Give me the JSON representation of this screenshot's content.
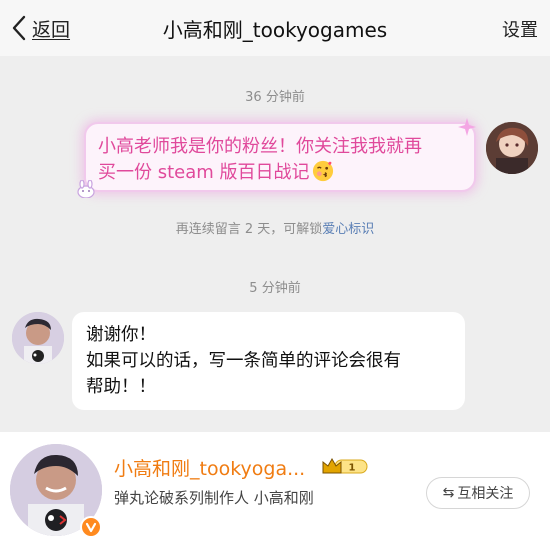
{
  "header": {
    "back_label": "返回",
    "title": "小高和刚_tookyogames",
    "settings_label": "设置"
  },
  "messages": {
    "timestamp_1": "36 分钟前",
    "fan_message_line1": "小高老师我是你的粉丝！你关注我我就再",
    "fan_message_line2": "买一份 steam 版百日战记",
    "unlock_prefix": "再连续留言 2 天，可解锁",
    "unlock_highlight": "爱心标识",
    "timestamp_2": "5 分钟前",
    "reply_line1": "谢谢你！",
    "reply_line2": "如果可以的话，写一条简单的评论会很有",
    "reply_line3": "帮助！！"
  },
  "profile_card": {
    "name": "小高和刚_tookyoga...",
    "level_badge": "1",
    "description": "弹丸论破系列制作人 小高和刚",
    "follow_label": "互相关注",
    "follow_icon": "⇆"
  },
  "icons": {
    "back": "chevron-left-icon",
    "emoji": "kiss-face-emoji",
    "crown": "crown-icon",
    "verify": "verified-badge-icon"
  },
  "colors": {
    "fan_text": "#e0499b",
    "name_orange": "#f07c12",
    "link_blue": "#5a7fb5"
  }
}
